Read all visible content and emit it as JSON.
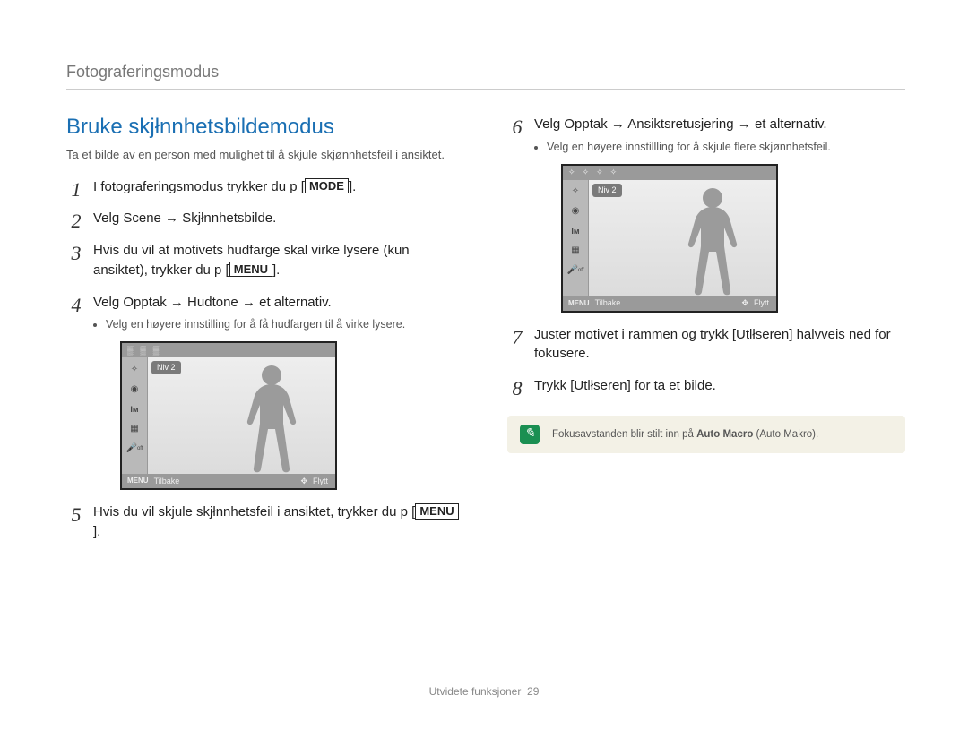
{
  "breadcrumb": "Fotograferingsmodus",
  "title": "Bruke skjłnnhetsbildemodus",
  "lead": "Ta et bilde av en person med mulighet til å skjule skjønnhetsfeil i ansiktet.",
  "buttons": {
    "mode": "MODE",
    "menu": "MENU"
  },
  "stepsLeft": [
    {
      "pre": "I fotograferingsmodus trykker du p  [",
      "btn": "mode",
      "post": "]."
    },
    {
      "text": "Velg Scene → Skjłnnhetsbilde."
    },
    {
      "pre": "Hvis du vil at motivets hudfarge skal virke lysere (kun ansiktet), trykker du p  [",
      "btn": "menu",
      "post": "]."
    },
    {
      "text": "Velg Opptak → Hudtone → et alternativ.",
      "sub": "Velg en høyere innstilling for å få hudfargen til å virke lysere."
    },
    {
      "pre": "Hvis du vil skjule skjłnnhetsfeil i ansiktet, trykker du p  [",
      "btn": "menu",
      "post": "]."
    }
  ],
  "stepsRight": [
    {
      "text": "Velg Opptak → Ansiktsretusjering → et alternativ.",
      "sub": "Velg en høyere innstillling for å skjule flere skjønnhetsfeil."
    },
    {
      "text": "Juster motivet i rammen og trykk [Utlłseren] halvveis ned for   fokusere."
    },
    {
      "text": "Trykk [Utlłseren] for   ta et bilde."
    }
  ],
  "lcd": {
    "pill": "Niv  2",
    "back": "Tilbake",
    "move": "Flytt",
    "menuLabel": "MENU",
    "padGlyph": "✥"
  },
  "callout": {
    "pre": "Fokusavstanden blir stilt inn på ",
    "bold": "Auto Macro",
    "post": "  (Auto Makro)."
  },
  "footer": {
    "section": "Utvidete funksjoner",
    "page": "29"
  }
}
